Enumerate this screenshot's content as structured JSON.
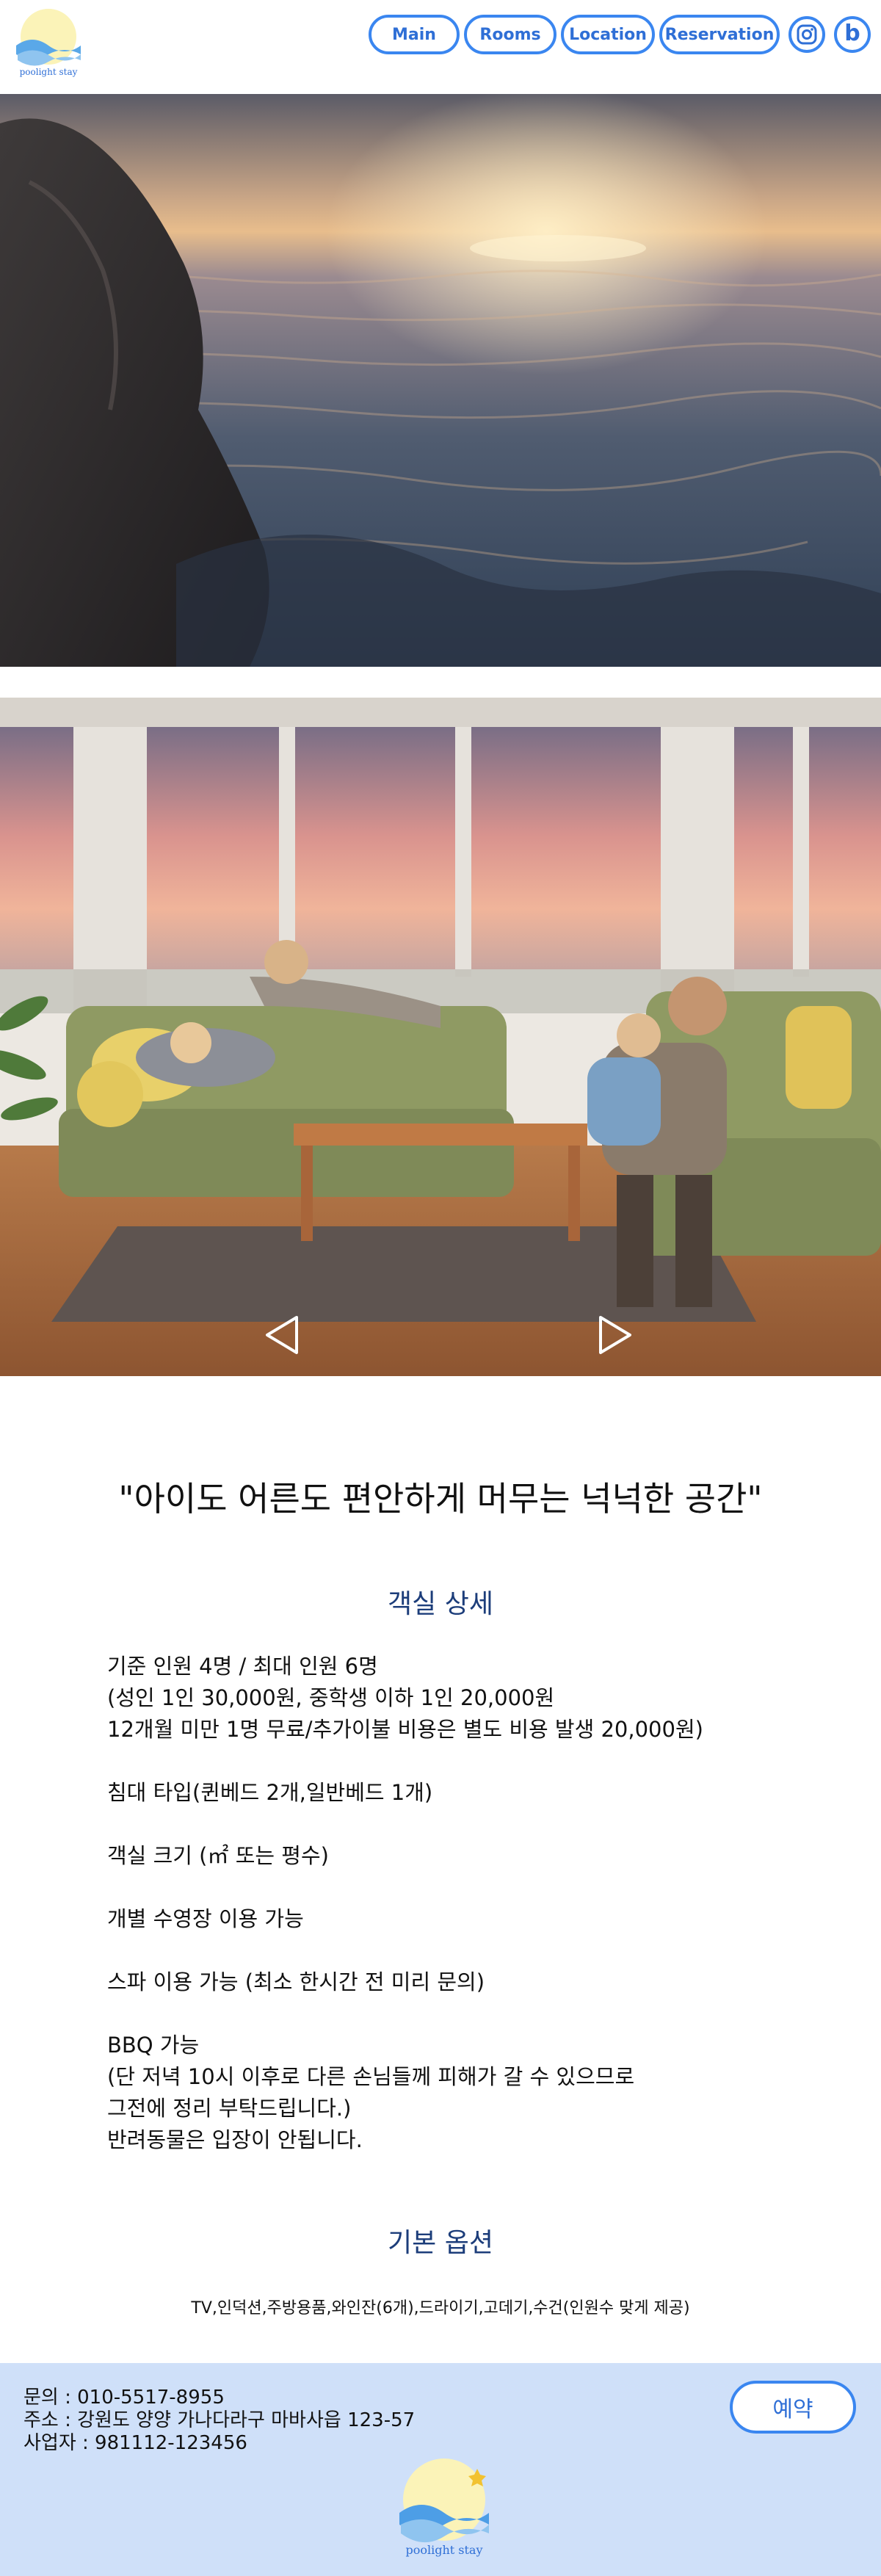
{
  "brand": {
    "logo_text": "poolight stay"
  },
  "nav": {
    "items": [
      "Main",
      "Rooms",
      "Location",
      "Reservation"
    ],
    "instagram_icon": "instagram-icon",
    "blog_icon": "blog-b-icon",
    "blog_letter": "b"
  },
  "hero": {
    "photo1": "ocean-rock-sunset-photo",
    "photo2": "family-living-room-photo"
  },
  "slider": {
    "prev_icon": "triangle-left-icon",
    "next_icon": "triangle-right-icon"
  },
  "quote": "\"아이도 어른도 편안하게 머무는 넉넉한 공간\"",
  "room_details": {
    "title": "객실 상세",
    "paragraphs": [
      "기준 인원 4명 / 최대 인원 6명\n(성인 1인 30,000원, 중학생 이하 1인 20,000원\n12개월 미만 1명 무료/추가이불 비용은 별도 비용 발생 20,000원)",
      "침대 타입(퀸베드 2개,일반베드 1개)",
      "객실 크기 (㎡ 또는 평수)",
      "개별 수영장 이용 가능",
      "스파 이용 가능 (최소 한시간 전 미리 문의)",
      "BBQ 가능\n(단 저녁 10시 이후로 다른 손님들께 피해가 갈 수 있으므로\n그전에 정리 부탁드립니다.)\n반려동물은 입장이 안됩니다."
    ]
  },
  "basic_options": {
    "title": "기본 옵션",
    "text": "TV,인덕션,주방용품,와인잔(6개),드라이기,고데기,수건(인원수 맞게 제공)"
  },
  "footer": {
    "phone": "문의 : 010-5517-8955",
    "address": "주소 : 강원도 양양 가나다라구 마바사읍 123-57",
    "business": "사업자 : 981112-123456",
    "reserve_label": "예약",
    "logo_text": "poolight stay"
  },
  "colors": {
    "accent": "#3a86f0",
    "title_blue": "#1c3d7a",
    "footer_bg": "#cfe0f9"
  }
}
